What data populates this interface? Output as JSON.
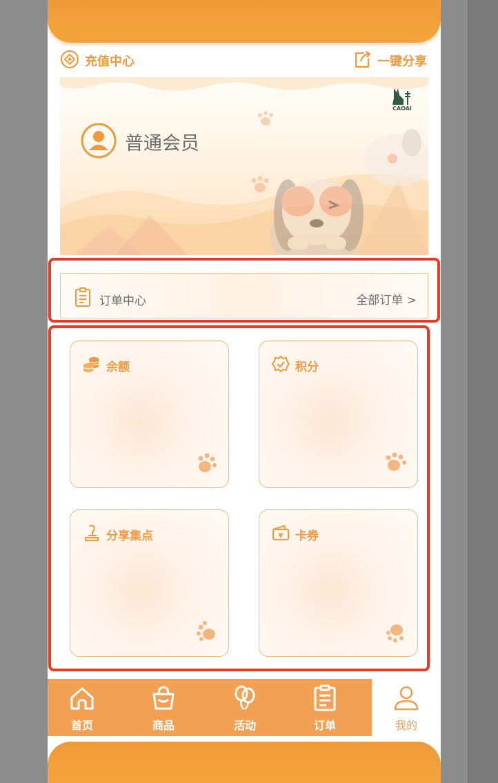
{
  "header": {
    "recharge_label": "充值中心",
    "share_label": "一键分享"
  },
  "banner": {
    "member_level": "普通会员",
    "logo_text": "CAOAI"
  },
  "order": {
    "title": "订单中心",
    "all_label": "全部订单 >"
  },
  "tiles": [
    {
      "label": "余额",
      "icon": "coins-icon"
    },
    {
      "label": "积分",
      "icon": "badge-check-icon"
    },
    {
      "label": "分享集点",
      "icon": "stamp-icon"
    },
    {
      "label": "卡券",
      "icon": "ticket-icon"
    }
  ],
  "tabbar": {
    "items": [
      {
        "label": "首页",
        "icon": "home-icon"
      },
      {
        "label": "商品",
        "icon": "bag-icon"
      },
      {
        "label": "活动",
        "icon": "balloon-icon"
      },
      {
        "label": "订单",
        "icon": "clipboard-icon"
      },
      {
        "label": "我的",
        "icon": "user-icon",
        "active": true
      }
    ]
  },
  "colors": {
    "accent": "#f09a3a",
    "tab_bg": "#f2a053",
    "highlight_border": "#e63b24",
    "text_gray": "#6a6a6a"
  }
}
